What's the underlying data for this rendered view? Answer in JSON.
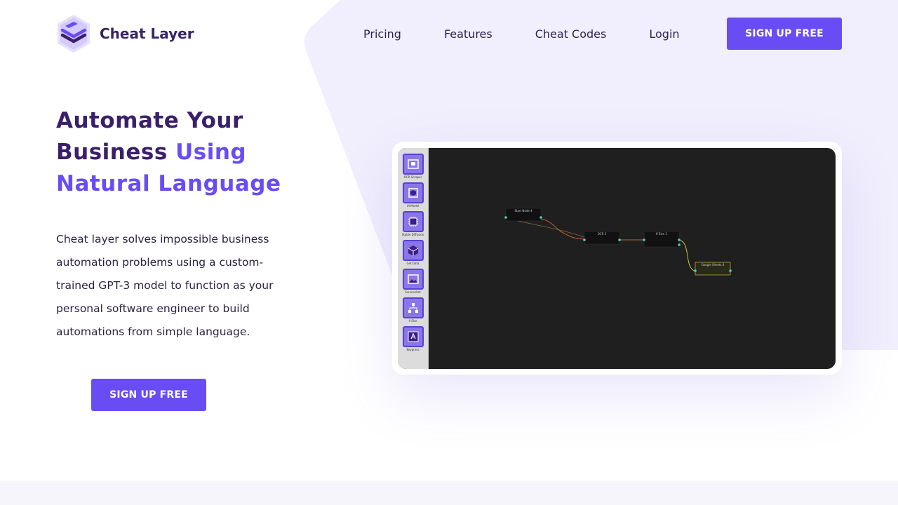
{
  "brand": {
    "name": "Cheat Layer",
    "accent_color": "#6a4cf5",
    "dark_color": "#3a1f6a",
    "logo_icon": "stacked-layers-icon"
  },
  "nav": {
    "items": [
      {
        "label": "Pricing"
      },
      {
        "label": "Features"
      },
      {
        "label": "Cheat Codes"
      },
      {
        "label": "Login"
      }
    ],
    "cta_label": "SIGN UP FREE"
  },
  "hero": {
    "title_line1": "Automate Your",
    "title_line2_plain": "Business ",
    "title_line2_accent": "Using",
    "title_line3_accent": "Natural Language",
    "description": "Cheat layer solves impossible business automation problems using a custom-trained GPT-3 model to function as your personal software engineer to build automations from simple language.",
    "cta_label": "SIGN UP FREE"
  },
  "app_preview": {
    "tools": [
      {
        "label": "OCR Scraper",
        "icon": "ocr-scraper-icon"
      },
      {
        "label": "UI Model",
        "icon": "ui-model-icon"
      },
      {
        "label": "Stable Diffusion",
        "icon": "chip-icon"
      },
      {
        "label": "Get Data",
        "icon": "box-icon"
      },
      {
        "label": "Screenshot",
        "icon": "image-icon"
      },
      {
        "label": "If Else",
        "icon": "branch-icon"
      },
      {
        "label": "Keypress",
        "icon": "key-a-icon"
      }
    ],
    "nodes": [
      {
        "label": "Start Node 4"
      },
      {
        "label": "OCR 2"
      },
      {
        "label": "If Else 1"
      },
      {
        "label": "Google Sheets 4"
      }
    ]
  }
}
